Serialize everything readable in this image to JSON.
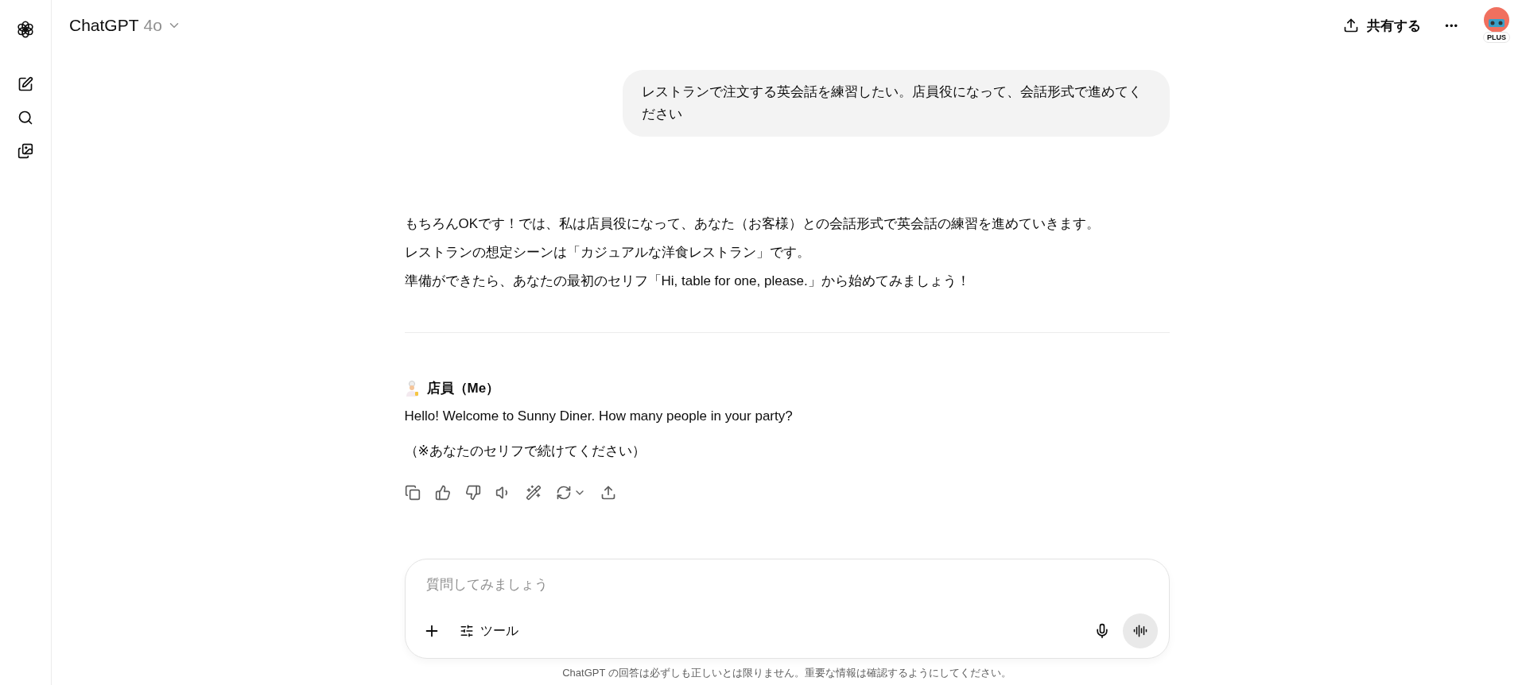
{
  "header": {
    "title": "ChatGPT",
    "model": "4o",
    "share_label": "共有する",
    "more_label": "•••",
    "plan_badge": "PLUS"
  },
  "user_message": "レストランで注文する英会話を練習したい。店員役になって、会話形式で進めてください",
  "assistant_intro": [
    "もちろんOKです！では、私は店員役になって、あなた（お客様）との会話形式で英会話の練習を進めていきます。",
    "レストランの想定シーンは「カジュアルな洋食レストラン」です。",
    "準備ができたら、あなたの最初のセリフ「Hi, table for one, please.」から始めてみましょう！"
  ],
  "speaker": "店員（Me）",
  "assistant_lines": [
    "Hello! Welcome to Sunny Diner. How many people in your party?",
    "（※あなたのセリフで続けてください）"
  ],
  "composer": {
    "placeholder": "質問してみましょう",
    "tools_label": "ツール"
  },
  "footer": "ChatGPT の回答は必ずしも正しいとは限りません。重要な情報は確認するようにしてください。"
}
